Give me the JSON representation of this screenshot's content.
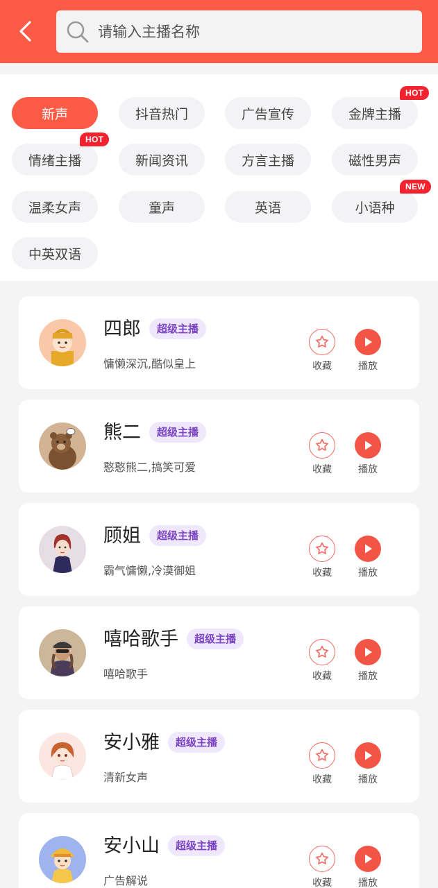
{
  "search": {
    "placeholder": "请输入主播名称"
  },
  "tags": [
    {
      "label": "新声",
      "active": true,
      "badge": ""
    },
    {
      "label": "抖音热门",
      "active": false,
      "badge": ""
    },
    {
      "label": "广告宣传",
      "active": false,
      "badge": ""
    },
    {
      "label": "金牌主播",
      "active": false,
      "badge": "HOT"
    },
    {
      "label": "情绪主播",
      "active": false,
      "badge": "HOT"
    },
    {
      "label": "新闻资讯",
      "active": false,
      "badge": ""
    },
    {
      "label": "方言主播",
      "active": false,
      "badge": ""
    },
    {
      "label": "磁性男声",
      "active": false,
      "badge": ""
    },
    {
      "label": "温柔女声",
      "active": false,
      "badge": ""
    },
    {
      "label": "童声",
      "active": false,
      "badge": ""
    },
    {
      "label": "英语",
      "active": false,
      "badge": ""
    },
    {
      "label": "小语种",
      "active": false,
      "badge": "NEW"
    },
    {
      "label": "中英双语",
      "active": false,
      "badge": ""
    }
  ],
  "anchors": [
    {
      "name": "四郎",
      "level": "超级主播",
      "desc": "慵懒深沉,酷似皇上",
      "fav_label": "收藏",
      "play_label": "播放",
      "avatar_icon": "emperor-avatar"
    },
    {
      "name": "熊二",
      "level": "超级主播",
      "desc": "憨憨熊二,搞笑可爱",
      "fav_label": "收藏",
      "play_label": "播放",
      "avatar_icon": "bear-avatar"
    },
    {
      "name": "顾姐",
      "level": "超级主播",
      "desc": "霸气慵懒,冷漠御姐",
      "fav_label": "收藏",
      "play_label": "播放",
      "avatar_icon": "woman-avatar"
    },
    {
      "name": "嘻哈歌手",
      "level": "超级主播",
      "desc": "嘻哈歌手",
      "fav_label": "收藏",
      "play_label": "播放",
      "avatar_icon": "rapper-avatar"
    },
    {
      "name": "安小雅",
      "level": "超级主播",
      "desc": "清新女声",
      "fav_label": "收藏",
      "play_label": "播放",
      "avatar_icon": "girl-avatar"
    },
    {
      "name": "安小山",
      "level": "超级主播",
      "desc": "广告解说",
      "fav_label": "收藏",
      "play_label": "播放",
      "avatar_icon": "boy-avatar"
    }
  ],
  "colors": {
    "primary": "#fe5b47",
    "badge_red": "#f2222e",
    "vip_text": "#7b45c3",
    "vip_bg": "#efe7fb"
  }
}
